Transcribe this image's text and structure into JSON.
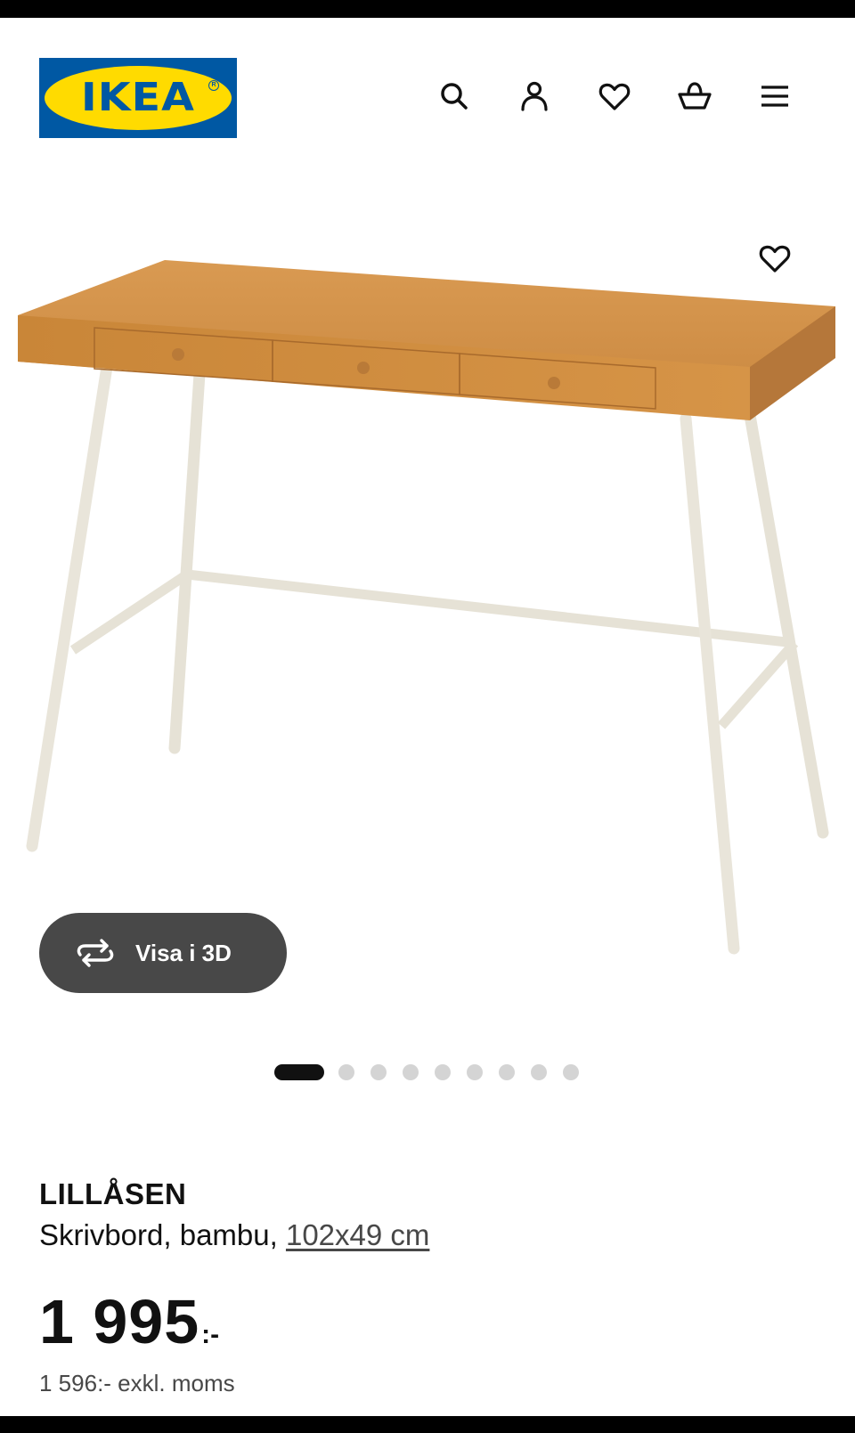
{
  "brand": {
    "logo_text": "IKEA",
    "reg_mark": "R",
    "colors": {
      "blue": "#0058a3",
      "yellow": "#ffdb00"
    }
  },
  "header": {
    "icons": [
      "search-icon",
      "account-icon",
      "favourites-icon",
      "cart-icon",
      "menu-icon"
    ]
  },
  "gallery": {
    "favourite_icon": "heart-icon",
    "view_3d_label": "Visa i 3D",
    "view_3d_icon": "rotate-arrows-icon",
    "image_count": 9,
    "active_index": 0
  },
  "product": {
    "name": "LILLÅSEN",
    "description": "Skrivbord, bambu, ",
    "size": "102x49 cm",
    "price": "1 995",
    "price_suffix": ":-",
    "price_excl_vat": "1 596:- exkl. moms"
  }
}
